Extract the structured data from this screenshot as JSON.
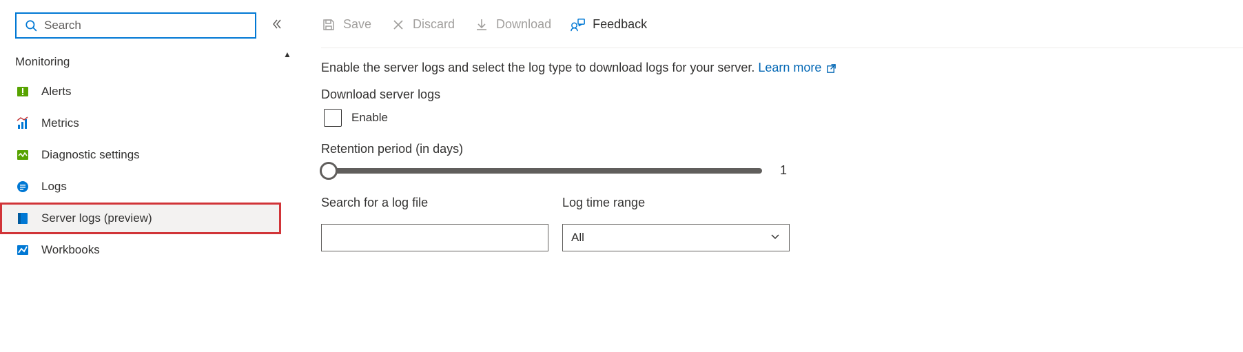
{
  "sidebar": {
    "search_placeholder": "Search",
    "section_title": "Monitoring",
    "items": [
      {
        "label": "Alerts"
      },
      {
        "label": "Metrics"
      },
      {
        "label": "Diagnostic settings"
      },
      {
        "label": "Logs"
      },
      {
        "label": "Server logs (preview)"
      },
      {
        "label": "Workbooks"
      }
    ]
  },
  "toolbar": {
    "save_label": "Save",
    "discard_label": "Discard",
    "download_label": "Download",
    "feedback_label": "Feedback"
  },
  "main": {
    "description": "Enable the server logs and select the log type to download logs for your server.",
    "learn_more": "Learn more",
    "download_heading": "Download server logs",
    "enable_label": "Enable",
    "retention_label": "Retention period (in days)",
    "retention_value": "1",
    "search_label": "Search for a log file",
    "search_value": "",
    "range_label": "Log time range",
    "range_value": "All"
  }
}
